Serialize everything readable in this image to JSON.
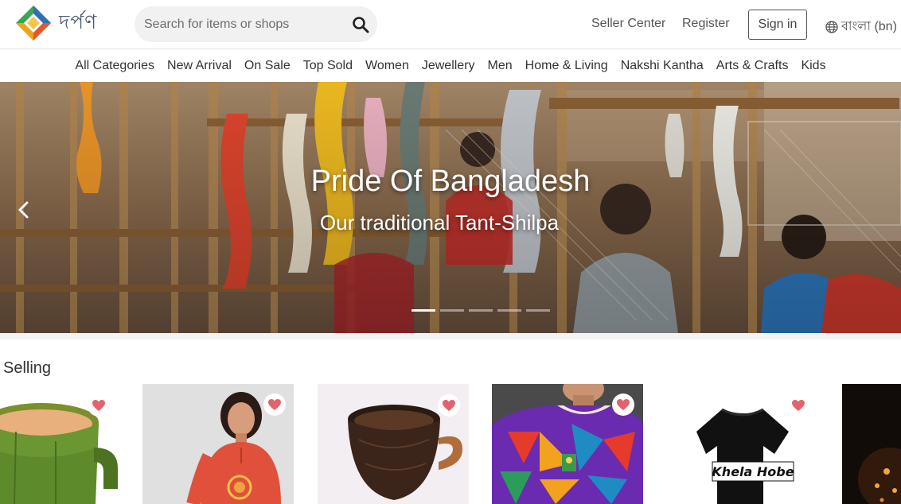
{
  "brand": {
    "name": "দর্পণ"
  },
  "search": {
    "placeholder": "Search for items or shops"
  },
  "header": {
    "seller_center": "Seller Center",
    "register": "Register",
    "sign_in": "Sign in",
    "language": "বাংলা (bn)"
  },
  "categories": [
    "All Categories",
    "New Arrival",
    "On Sale",
    "Top Sold",
    "Women",
    "Jewellery",
    "Men",
    "Home & Living",
    "Nakshi Kantha",
    "Arts & Crafts",
    "Kids"
  ],
  "hero": {
    "title": "Pride Of Bangladesh",
    "subtitle": "Our traditional Tant-Shilpa",
    "slide_count": 5,
    "active_slide": 1
  },
  "selling": {
    "title": "Selling",
    "product_tshirt_text": "Khela Hobe"
  },
  "colors": {
    "accent_heart": "#e2636d",
    "logo_green": "#3aa651",
    "logo_orange": "#f0a21e",
    "logo_blue": "#2f6fb3"
  },
  "icons": [
    "search-icon",
    "globe-icon",
    "chevron-left-icon",
    "heart-icon"
  ]
}
